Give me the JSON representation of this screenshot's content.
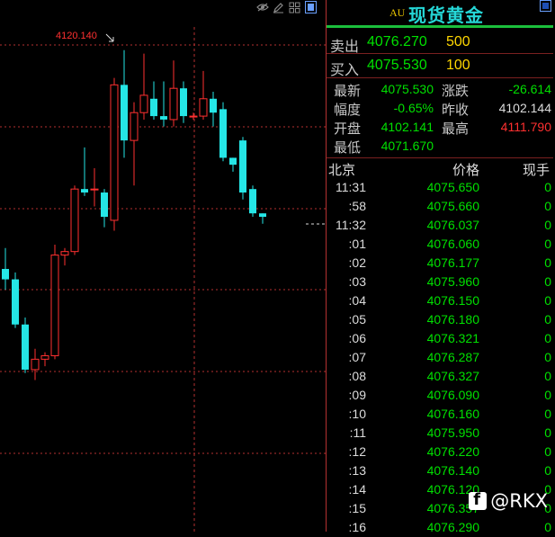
{
  "chart": {
    "high_label": "4120.140",
    "colors": {
      "up": "#ff3030",
      "down": "#25e6e6",
      "grid": "#b43030",
      "label": "#ff3030"
    },
    "candles": [
      {
        "o": 4071.9,
        "h": 4072.5,
        "l": 4071.3,
        "c": 4071.6
      },
      {
        "o": 4071.6,
        "h": 4071.8,
        "l": 4070.2,
        "c": 4070.3
      },
      {
        "o": 4070.3,
        "h": 4070.5,
        "l": 4068.9,
        "c": 4069.0
      },
      {
        "o": 4069.0,
        "h": 4069.6,
        "l": 4068.7,
        "c": 4069.3
      },
      {
        "o": 4069.3,
        "h": 4069.5,
        "l": 4069.1,
        "c": 4069.4
      },
      {
        "o": 4069.4,
        "h": 4072.6,
        "l": 4069.3,
        "c": 4072.3
      },
      {
        "o": 4072.3,
        "h": 4072.5,
        "l": 4072.0,
        "c": 4072.4
      },
      {
        "o": 4072.4,
        "h": 4074.3,
        "l": 4072.3,
        "c": 4074.2
      },
      {
        "o": 4074.2,
        "h": 4075.4,
        "l": 4074.0,
        "c": 4074.1
      },
      {
        "o": 4074.2,
        "h": 4074.8,
        "l": 4073.7,
        "c": 4074.2
      },
      {
        "o": 4074.1,
        "h": 4074.2,
        "l": 4073.1,
        "c": 4073.4
      },
      {
        "o": 4073.3,
        "h": 4077.4,
        "l": 4073.0,
        "c": 4077.2
      },
      {
        "o": 4077.2,
        "h": 4078.2,
        "l": 4075.1,
        "c": 4075.6
      },
      {
        "o": 4075.6,
        "h": 4076.7,
        "l": 4074.3,
        "c": 4076.4
      },
      {
        "o": 4076.4,
        "h": 4078.1,
        "l": 4076.2,
        "c": 4076.9
      },
      {
        "o": 4076.8,
        "h": 4077.3,
        "l": 4076.2,
        "c": 4076.3
      },
      {
        "o": 4076.3,
        "h": 4077.3,
        "l": 4076.0,
        "c": 4076.2
      },
      {
        "o": 4076.2,
        "h": 4077.9,
        "l": 4076.0,
        "c": 4077.1
      },
      {
        "o": 4077.1,
        "h": 4077.3,
        "l": 4076.1,
        "c": 4076.3
      },
      {
        "o": 4076.3,
        "h": 4076.4,
        "l": 4076.2,
        "c": 4076.3
      },
      {
        "o": 4076.3,
        "h": 4077.6,
        "l": 4076.2,
        "c": 4076.8
      },
      {
        "o": 4076.8,
        "h": 4077.0,
        "l": 4076.0,
        "c": 4076.4
      },
      {
        "o": 4076.5,
        "h": 4076.7,
        "l": 4075.0,
        "c": 4075.1
      },
      {
        "o": 4075.1,
        "h": 4075.1,
        "l": 4074.7,
        "c": 4074.9
      },
      {
        "o": 4075.6,
        "h": 4075.7,
        "l": 4073.9,
        "c": 4074.1
      },
      {
        "o": 4074.2,
        "h": 4074.3,
        "l": 4073.4,
        "c": 4073.5
      },
      {
        "o": 4073.5,
        "h": 4073.5,
        "l": 4073.2,
        "c": 4073.4
      }
    ]
  },
  "toolbar": {
    "icons": [
      "eye-icon",
      "pencil-icon",
      "grid-icon",
      "panel-icon"
    ]
  },
  "quote": {
    "symbol": "AU",
    "name": "现货黄金",
    "sell_label": "卖出",
    "sell_price": "4076.270",
    "sell_vol": "500",
    "buy_label": "买入",
    "buy_price": "4075.530",
    "buy_vol": "100",
    "latest_label": "最新",
    "latest": "4075.530",
    "change_label": "涨跌",
    "change": "-26.614",
    "pct_label": "幅度",
    "pct": "-0.65%",
    "prev_label": "昨收",
    "prev": "4102.144",
    "open_label": "开盘",
    "open": "4102.141",
    "high_label": "最高",
    "high": "4111.790",
    "low_label": "最低",
    "low": "4071.670",
    "ticks_head": {
      "time": "北京",
      "price": "价格",
      "qty": "现手"
    },
    "ticks": [
      {
        "t": "11:31",
        "p": "4075.650",
        "q": "0"
      },
      {
        "t": ":58",
        "p": "4075.660",
        "q": "0"
      },
      {
        "t": "11:32",
        "p": "4076.037",
        "q": "0"
      },
      {
        "t": ":01",
        "p": "4076.060",
        "q": "0"
      },
      {
        "t": ":02",
        "p": "4076.177",
        "q": "0"
      },
      {
        "t": ":03",
        "p": "4075.960",
        "q": "0"
      },
      {
        "t": ":04",
        "p": "4076.150",
        "q": "0"
      },
      {
        "t": ":05",
        "p": "4076.180",
        "q": "0"
      },
      {
        "t": ":06",
        "p": "4076.321",
        "q": "0"
      },
      {
        "t": ":07",
        "p": "4076.287",
        "q": "0"
      },
      {
        "t": ":08",
        "p": "4076.327",
        "q": "0"
      },
      {
        "t": ":09",
        "p": "4076.090",
        "q": "0"
      },
      {
        "t": ":10",
        "p": "4076.160",
        "q": "0"
      },
      {
        "t": ":11",
        "p": "4075.950",
        "q": "0"
      },
      {
        "t": ":12",
        "p": "4076.220",
        "q": "0"
      },
      {
        "t": ":13",
        "p": "4076.140",
        "q": "0"
      },
      {
        "t": ":14",
        "p": "4076.120",
        "q": "0"
      },
      {
        "t": ":15",
        "p": "4076.357",
        "q": "0"
      },
      {
        "t": ":16",
        "p": "4076.290",
        "q": "0"
      }
    ]
  },
  "watermark": "@RKX"
}
